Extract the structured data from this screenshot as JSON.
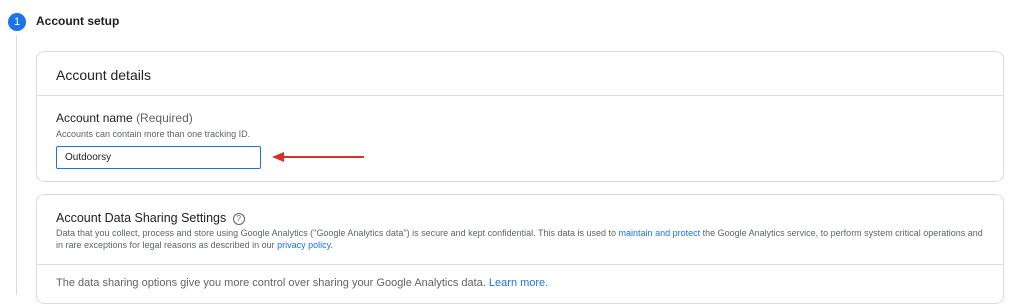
{
  "step": {
    "number": "1",
    "title": "Account setup"
  },
  "account_details": {
    "header": "Account details",
    "name_label": "Account name",
    "required_label": "(Required)",
    "help_text": "Accounts can contain more than one tracking ID.",
    "name_value": "Outdoorsy"
  },
  "sharing": {
    "title": "Account Data Sharing Settings",
    "help_icon_glyph": "?",
    "desc_part1": "Data that you collect, process and store using Google Analytics (\"Google Analytics data\") is secure and kept confidential. This data is used to ",
    "desc_link1": "maintain and protect",
    "desc_part2": " the Google Analytics service, to perform system critical operations and in rare exceptions for legal reasons as described in our ",
    "desc_link2": "privacy policy",
    "desc_part3": ".",
    "options_text": "The data sharing options give you more control over sharing your Google Analytics data. ",
    "learn_more": "Learn more."
  },
  "colors": {
    "accent": "#1a73e8",
    "annotation_arrow": "#d93025"
  }
}
